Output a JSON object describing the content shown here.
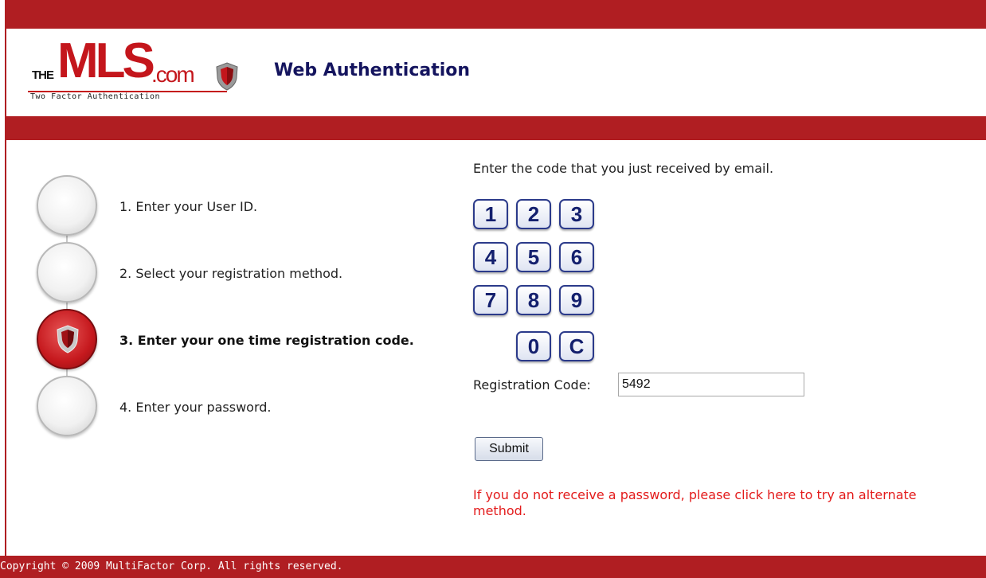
{
  "colors": {
    "brand_red": "#b01e22",
    "title_navy": "#14145e",
    "link_red": "#e31b1b",
    "key_blue": "#14206e"
  },
  "header": {
    "logo": {
      "the": "THE",
      "mls": "MLS",
      "com": ".com",
      "subtitle": "Two Factor Authentication",
      "icon": "shield-icon"
    },
    "title": "Web Authentication"
  },
  "steps": [
    {
      "label": "1. Enter your User ID.",
      "active": false
    },
    {
      "label": "2. Select your registration method.",
      "active": false
    },
    {
      "label": "3. Enter your one time registration code.",
      "active": true,
      "icon": "shield-icon"
    },
    {
      "label": "4. Enter your password.",
      "active": false
    }
  ],
  "main": {
    "instruction": "Enter the code that you just received by email.",
    "keypad": [
      "1",
      "2",
      "3",
      "4",
      "5",
      "6",
      "7",
      "8",
      "9",
      "0",
      "C"
    ],
    "code_label": "Registration Code:",
    "code_value": "5492",
    "submit_label": "Submit",
    "alt_link": "If you do not receive a password, please click here to try an alternate method."
  },
  "footer": {
    "copyright": "Copyright © 2009 MultiFactor Corp. All rights reserved."
  }
}
